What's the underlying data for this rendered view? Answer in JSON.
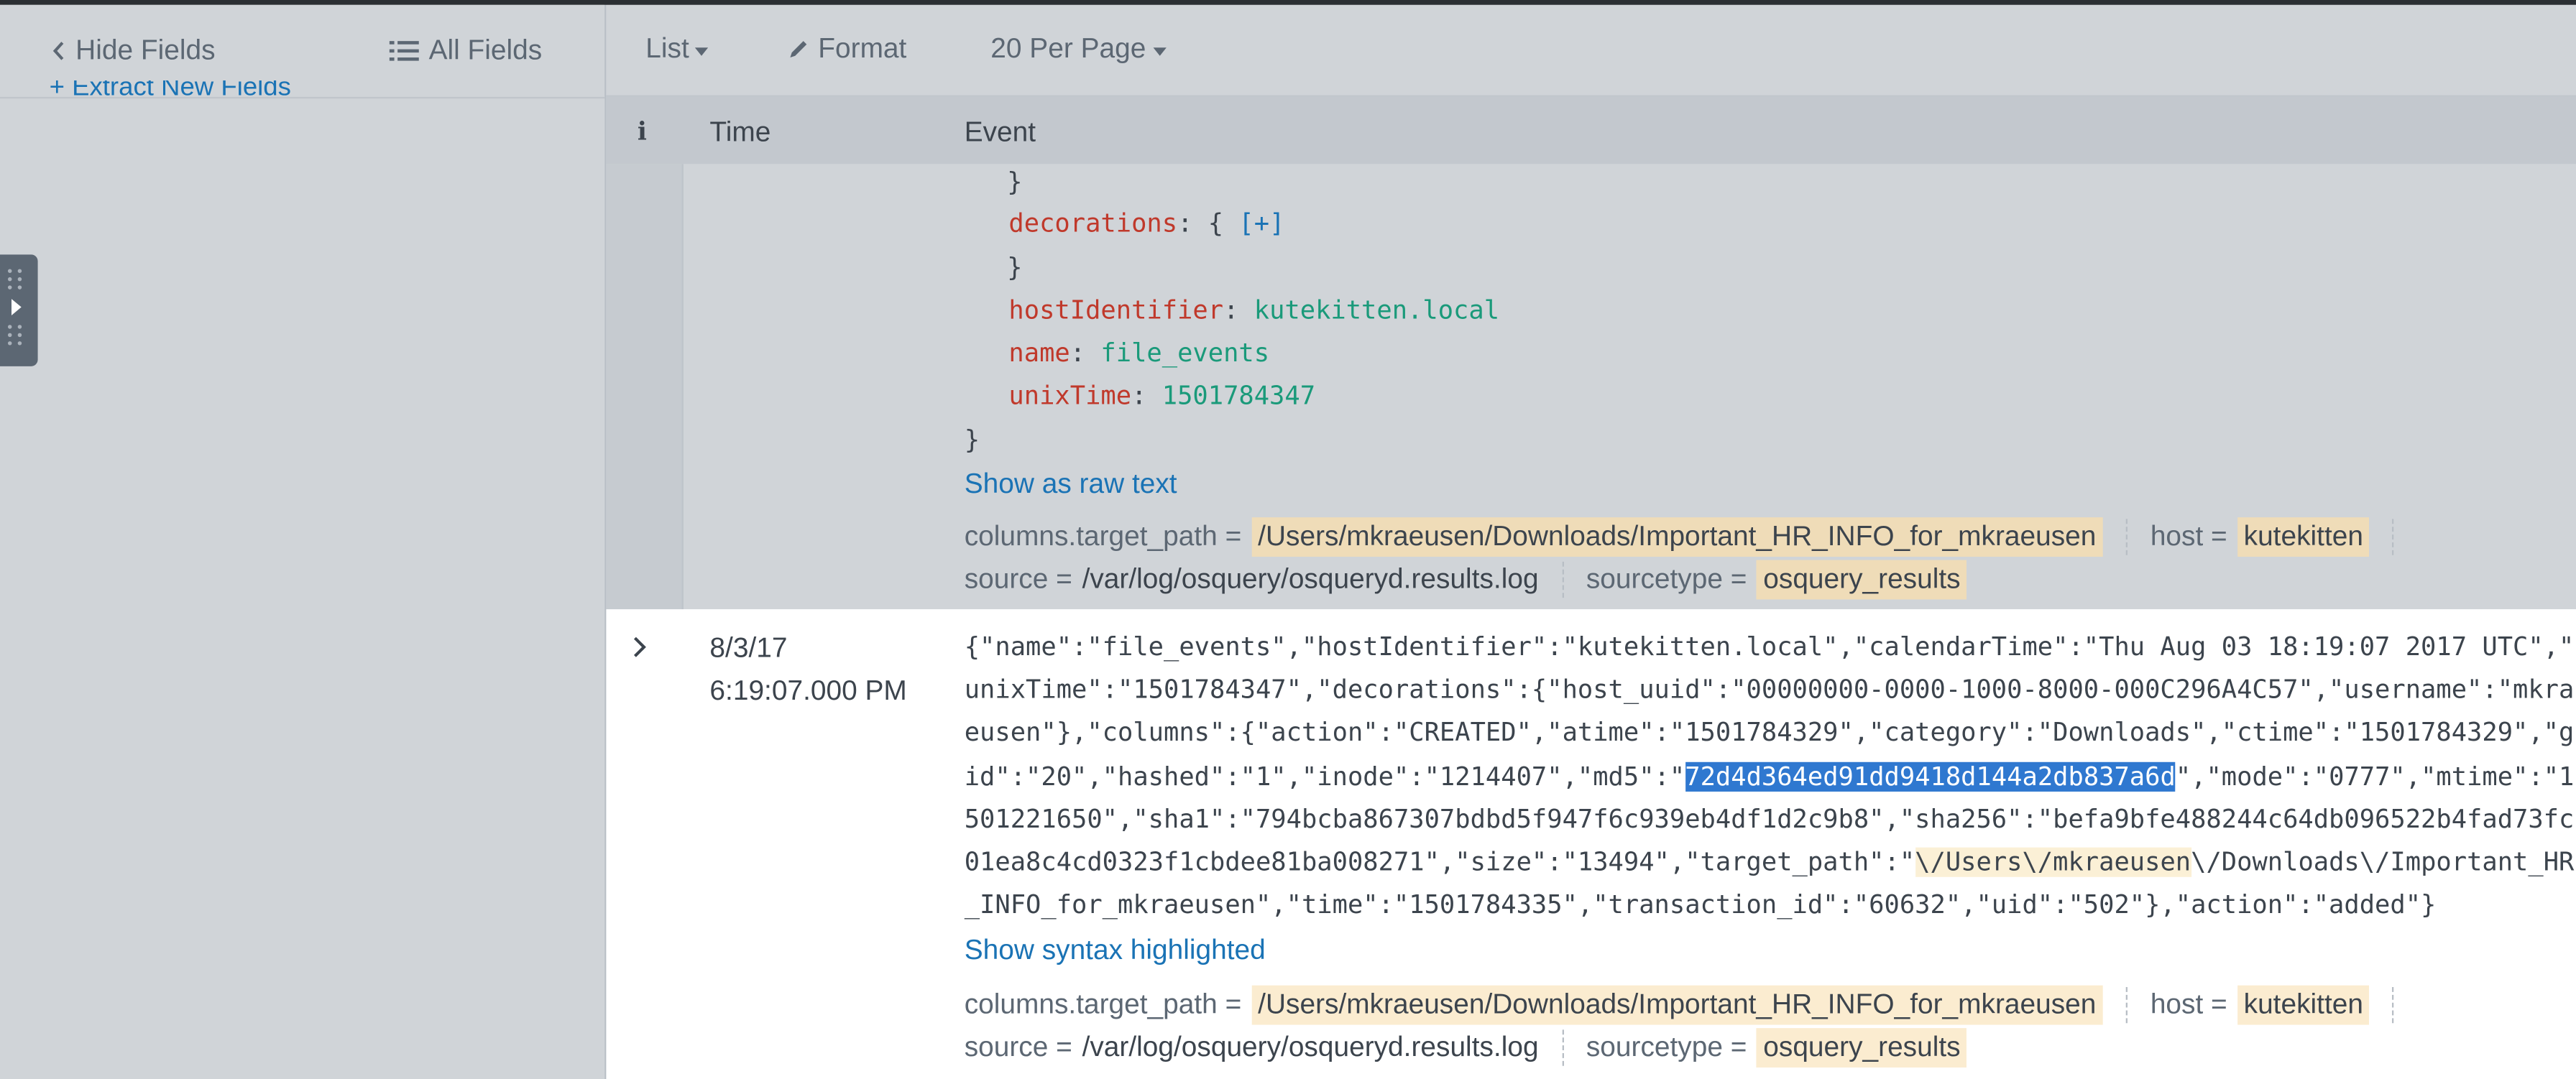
{
  "sidebar": {
    "hide_fields": "Hide Fields",
    "all_fields": "All Fields",
    "extract_link": "+ Extract New Fields"
  },
  "toolbar": {
    "list": "List",
    "format": "Format",
    "per_page": "20 Per Page"
  },
  "table": {
    "col_info": "i",
    "col_time": "Time",
    "col_event": "Event"
  },
  "event1": {
    "lines": [
      {
        "text": "}"
      },
      {
        "key": "decorations",
        "val": "{ [+]"
      },
      {
        "text": "}"
      },
      {
        "key": "hostIdentifier",
        "val": "kutekitten.local"
      },
      {
        "key": "name",
        "val": "file_events"
      },
      {
        "key": "unixTime",
        "val": "1501784347"
      },
      {
        "text": "}"
      }
    ],
    "toggle_link": "Show as raw text",
    "fields": {
      "target_path_label": "columns.target_path =",
      "target_path_value": "/Users/mkraeusen/Downloads/Important_HR_INFO_for_mkraeusen",
      "host_label": "host =",
      "host_value": "kutekitten",
      "source_label": "source =",
      "source_value": "/var/log/osquery/osqueryd.results.log",
      "sourcetype_label": "sourcetype =",
      "sourcetype_value": "osquery_results"
    }
  },
  "event2": {
    "date": "8/3/17",
    "time": "6:19:07.000 PM",
    "raw_lines": {
      "l1": "{\"name\":\"file_events\",\"hostIdentifier\":\"kutekitten.local\",\"calendarTime\":\"Thu Aug 03 18:19:07 2017 UTC\",\"",
      "l2": "unixTime\":\"1501784347\",\"decorations\":{\"host_uuid\":\"00000000-0000-1000-8000-000C296A4C57\",\"username\":\"mkra",
      "l3": "eusen\"},\"columns\":{\"action\":\"CREATED\",\"atime\":\"1501784329\",\"category\":\"Downloads\",\"ctime\":\"1501784329\",\"g",
      "l4a": "id\":\"20\",\"hashed\":\"1\",\"inode\":\"1214407\",\"md5\":\"",
      "l4hl": "72d4d364ed91dd9418d144a2db837a6d",
      "l4b": "\",\"mode\":\"0777\",\"mtime\":\"1",
      "l5": "501221650\",\"sha1\":\"794bcba867307bdbd5f947f6c939eb4df1d2c9b8\",\"sha256\":\"befa9bfe488244c64db096522b4fad73fc",
      "l6": "01ea8c4cd0323f1cbdee81ba008271\",\"size\":\"13494\",\"target_path\":\"",
      "l6hl": "\\/Users\\/mkraeusen",
      "l6b": "\\/Downloads\\/Important_HR",
      "l7": "_INFO_for_mkraeusen\",\"time\":\"1501784335\",\"transaction_id\":\"60632\",\"uid\":\"502\"},\"action\":\"added\"}"
    },
    "toggle_link": "Show syntax highlighted",
    "fields": {
      "target_path_label": "columns.target_path =",
      "target_path_value": "/Users/mkraeusen/Downloads/Important_HR_INFO_for_mkraeusen",
      "host_label": "host =",
      "host_value": "kutekitten",
      "source_label": "source =",
      "source_value": "/var/log/osquery/osqueryd.results.log",
      "sourcetype_label": "sourcetype =",
      "sourcetype_value": "osquery_results"
    }
  },
  "colors": {
    "link": "#1a73b5",
    "key": "#c0392b",
    "value": "#1a9a7a",
    "selection": "#2f78d0",
    "field_highlight": "#efdcb8"
  }
}
